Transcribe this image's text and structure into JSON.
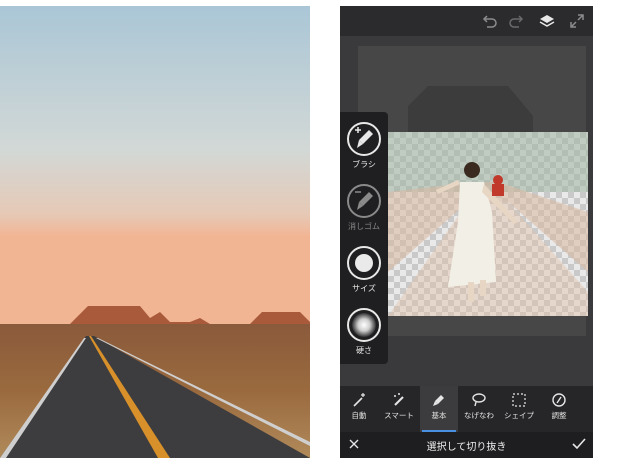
{
  "left_photo": {
    "scene": "desert-road-sunset"
  },
  "top_bar": {
    "icons": [
      "undo-icon",
      "redo-icon",
      "layers-icon",
      "fullscreen-icon"
    ]
  },
  "side_tools": {
    "brush_label": "ブラシ",
    "eraser_label": "消しゴム",
    "size_label": "サイズ",
    "hardness_label": "硬さ"
  },
  "toolbar": {
    "items": [
      {
        "label": "自動",
        "icon": "magic-wand-icon"
      },
      {
        "label": "スマート",
        "icon": "smart-brush-icon"
      },
      {
        "label": "基本",
        "icon": "brush-icon",
        "active": true
      },
      {
        "label": "なげなわ",
        "icon": "lasso-icon"
      },
      {
        "label": "シェイプ",
        "icon": "shape-icon"
      },
      {
        "label": "調整",
        "icon": "adjust-icon"
      }
    ]
  },
  "bottom_bar": {
    "title": "選択して切り抜き",
    "cancel_icon": "close-icon",
    "confirm_icon": "check-icon"
  },
  "colors": {
    "accent": "#4a90e2",
    "panel": "#2b2b2d",
    "toolbar": "#262628"
  }
}
